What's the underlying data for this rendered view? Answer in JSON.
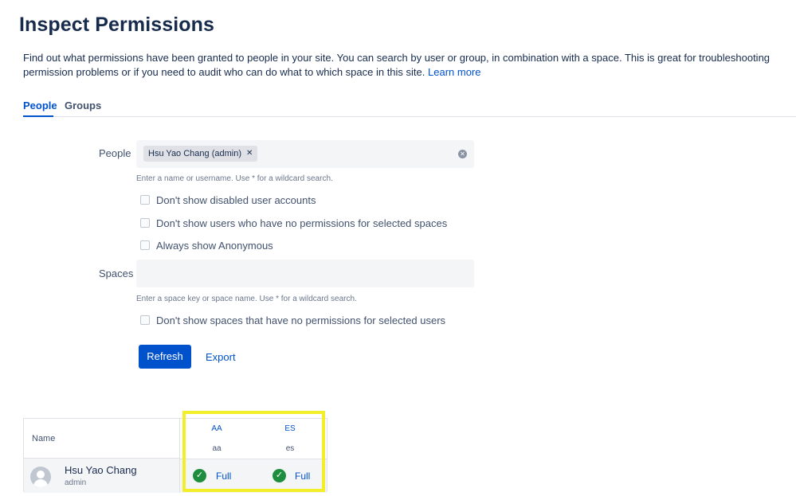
{
  "page": {
    "title": "Inspect Permissions",
    "intro": "Find out what permissions have been granted to people in your site. You can search by user or group, in combination with a space. This is great for troubleshooting permission problems or if you need to audit who can do what to which space in this site.",
    "learn_more": "Learn more"
  },
  "tabs": [
    {
      "label": "People",
      "active": true
    },
    {
      "label": "Groups",
      "active": false
    }
  ],
  "form": {
    "people_label": "People",
    "people_chip": "Hsu Yao Chang (admin)",
    "people_hint": "Enter a name or username. Use * for a wildcard search.",
    "checkboxes": [
      "Don't show disabled user accounts",
      "Don't show users who have no permissions for selected spaces",
      "Always show Anonymous"
    ],
    "spaces_label": "Spaces",
    "spaces_value": "",
    "spaces_hint": "Enter a space key or space name. Use * for a wildcard search.",
    "spaces_checkbox": "Don't show spaces that have no permissions for selected users",
    "refresh_label": "Refresh",
    "export_label": "Export"
  },
  "results": {
    "name_header": "Name",
    "spaces": [
      {
        "key": "AA",
        "name": "aa"
      },
      {
        "key": "ES",
        "name": "es"
      }
    ],
    "rows": [
      {
        "name": "Hsu Yao Chang",
        "username": "admin",
        "permissions": [
          "Full",
          "Full"
        ]
      }
    ]
  },
  "colors": {
    "accent": "#0052cc",
    "success": "#1e8e3e",
    "highlight": "#f3ee2a"
  }
}
